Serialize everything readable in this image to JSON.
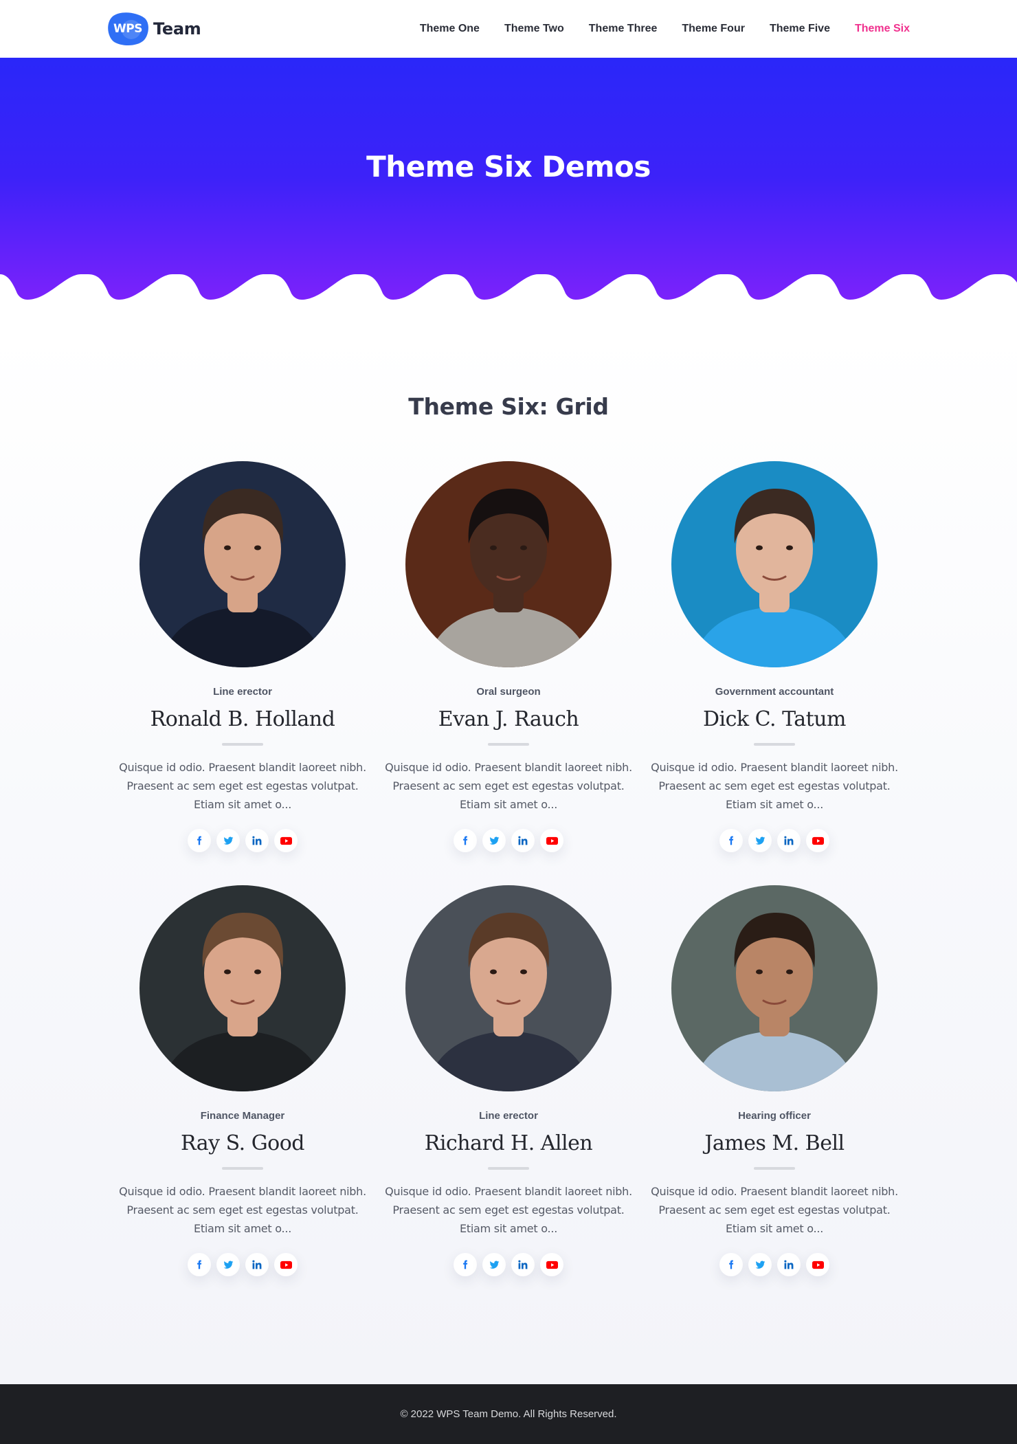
{
  "header": {
    "logo_badge": "WPS",
    "logo_text": "Team",
    "nav": [
      {
        "label": "Theme One",
        "active": false
      },
      {
        "label": "Theme Two",
        "active": false
      },
      {
        "label": "Theme Three",
        "active": false
      },
      {
        "label": "Theme Four",
        "active": false
      },
      {
        "label": "Theme Five",
        "active": false
      },
      {
        "label": "Theme Six",
        "active": true
      }
    ]
  },
  "hero": {
    "title": "Theme Six Demos",
    "gradient_top": "#2a27f9",
    "gradient_bottom": "#7b22fb"
  },
  "section": {
    "title": "Theme Six: Grid"
  },
  "members": [
    {
      "job": "Line erector",
      "name": "Ronald B. Holland",
      "bg": "#1f2b44",
      "skin": "#d7a488",
      "hair": "#3a2a22",
      "shirt": "#141a2a",
      "desc": [
        "Quisque id odio. Praesent blandit laoreet nibh.",
        "Praesent ac sem eget est egestas volutpat.",
        "Etiam sit amet o..."
      ]
    },
    {
      "job": "Oral surgeon",
      "name": "Evan J. Rauch",
      "bg": "#5a2a18",
      "skin": "#4a2c20",
      "hair": "#161010",
      "shirt": "#a8a49e",
      "desc": [
        "Quisque id odio. Praesent blandit laoreet nibh.",
        "Praesent ac sem eget est egestas volutpat.",
        "Etiam sit amet o..."
      ]
    },
    {
      "job": "Government accountant",
      "name": "Dick C. Tatum",
      "bg": "#1a8cc4",
      "skin": "#e1b59c",
      "hair": "#3b2a22",
      "shirt": "#2aa3e8",
      "desc": [
        "Quisque id odio. Praesent blandit laoreet nibh.",
        "Praesent ac sem eget est egestas volutpat.",
        "Etiam sit amet o..."
      ]
    },
    {
      "job": "Finance Manager",
      "name": "Ray S. Good",
      "bg": "#2b3134",
      "skin": "#d9a58a",
      "hair": "#6b4a33",
      "shirt": "#1c1f22",
      "desc": [
        "Quisque id odio. Praesent blandit laoreet nibh.",
        "Praesent ac sem eget est egestas volutpat.",
        "Etiam sit amet o..."
      ]
    },
    {
      "job": "Line erector",
      "name": "Richard H. Allen",
      "bg": "#4a5058",
      "skin": "#d9a88f",
      "hair": "#5a3b28",
      "shirt": "#2c3140",
      "desc": [
        "Quisque id odio. Praesent blandit laoreet nibh.",
        "Praesent ac sem eget est egestas volutpat.",
        "Etiam sit amet o..."
      ]
    },
    {
      "job": "Hearing officer",
      "name": "James M. Bell",
      "bg": "#5b6864",
      "skin": "#b98566",
      "hair": "#2a1d16",
      "shirt": "#a9bfd3",
      "desc": [
        "Quisque id odio. Praesent blandit laoreet nibh.",
        "Praesent ac sem eget est egestas volutpat.",
        "Etiam sit amet o..."
      ]
    }
  ],
  "social_icons": [
    {
      "name": "facebook",
      "glyph": "f",
      "color": "#1877f2"
    },
    {
      "name": "twitter",
      "glyph": "twitter-bird",
      "color": "#1da1f2"
    },
    {
      "name": "linkedin",
      "glyph": "in",
      "color": "#0a66c2"
    },
    {
      "name": "youtube",
      "glyph": "play",
      "color": "#ff0000"
    }
  ],
  "accent_colors": {
    "nav_active": "#f0318e",
    "logo_blue": "#2f6ff5",
    "footer_bg": "#1e1f23"
  },
  "footer": {
    "copyright": "© 2022 WPS Team Demo. All Rights Reserved."
  }
}
